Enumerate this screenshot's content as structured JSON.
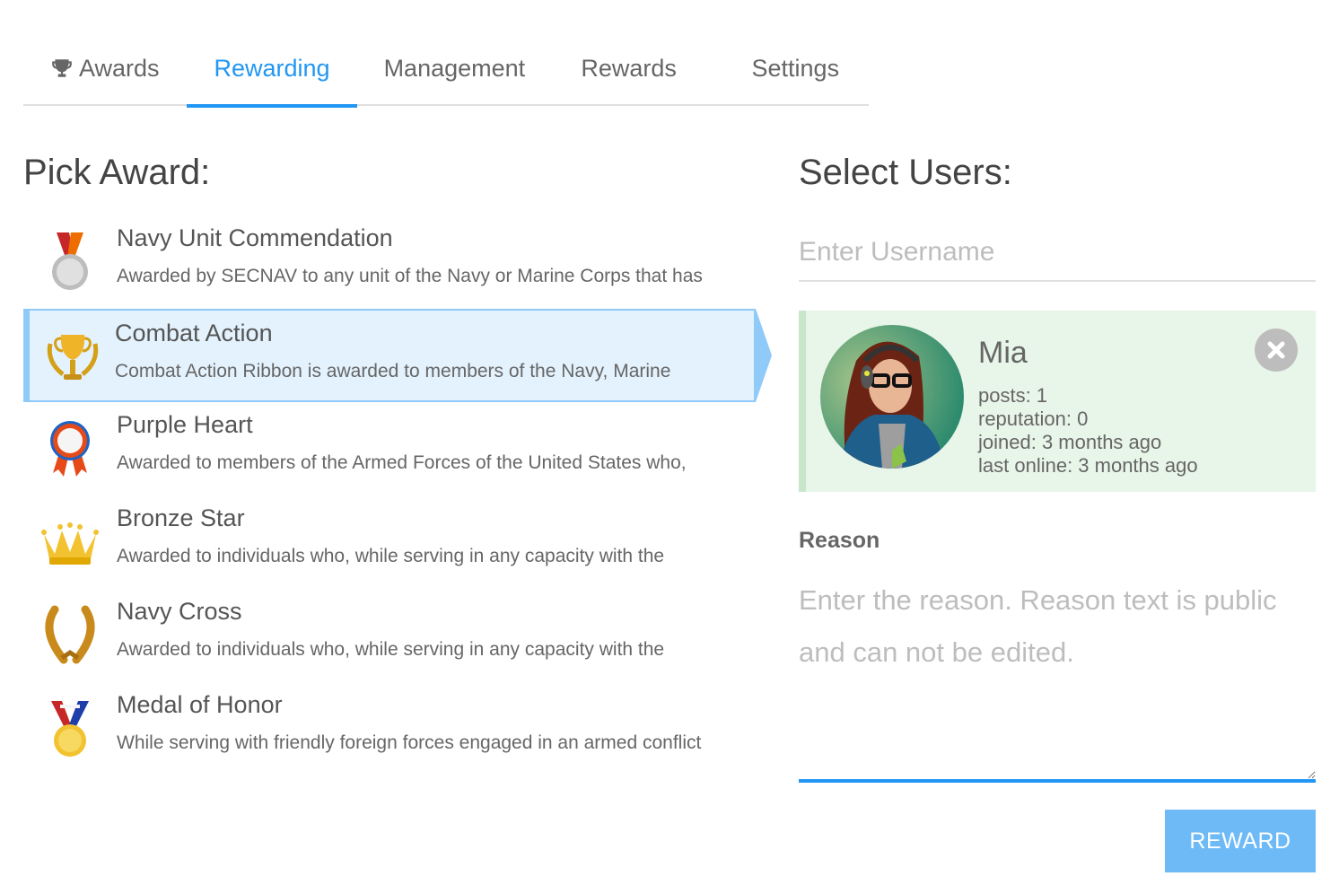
{
  "tabs": [
    {
      "label": "Awards",
      "icon": "trophy-icon",
      "active": false
    },
    {
      "label": "Rewarding",
      "active": true
    },
    {
      "label": "Management",
      "active": false
    },
    {
      "label": "Rewards",
      "active": false
    },
    {
      "label": "Settings",
      "active": false
    }
  ],
  "pick_award": {
    "heading": "Pick Award:",
    "awards": [
      {
        "title": "Navy Unit Commendation",
        "description": "Awarded by SECNAV to any unit of the Navy or Marine Corps that has",
        "icon": "silver-medal-icon",
        "selected": false
      },
      {
        "title": "Combat Action",
        "description": "Combat Action Ribbon is awarded to members of the Navy, Marine",
        "icon": "gold-trophy-icon",
        "selected": true
      },
      {
        "title": "Purple Heart",
        "description": "Awarded to members of the Armed Forces of the United States who,",
        "icon": "rosette-ribbon-icon",
        "selected": false
      },
      {
        "title": "Bronze Star",
        "description": "Awarded to individuals who, while serving in any capacity with the",
        "icon": "crown-icon",
        "selected": false
      },
      {
        "title": "Navy Cross",
        "description": "Awarded to individuals who, while serving in any capacity with the",
        "icon": "laurel-wreath-icon",
        "selected": false
      },
      {
        "title": "Medal of Honor",
        "description": "While serving with friendly foreign forces engaged in an armed conflict",
        "icon": "gold-medal-icon",
        "selected": false
      }
    ]
  },
  "select_users": {
    "heading": "Select Users:",
    "username_placeholder": "Enter Username",
    "username_value": "",
    "selected_user": {
      "name": "Mia",
      "posts": "posts: 1",
      "reputation": "reputation: 0",
      "joined": "joined: 3 months ago",
      "last_online": "last online: 3 months ago"
    }
  },
  "reason": {
    "label": "Reason",
    "placeholder": "Enter the reason. Reason text is public and can not be edited.",
    "value": ""
  },
  "reward_button": "REWARD",
  "colors": {
    "accent": "#2196f3",
    "selected_bg": "#e3f2fd",
    "selected_border": "#90caf9",
    "user_card_bg": "#e8f5e9",
    "button_bg": "#6ebaf7"
  }
}
